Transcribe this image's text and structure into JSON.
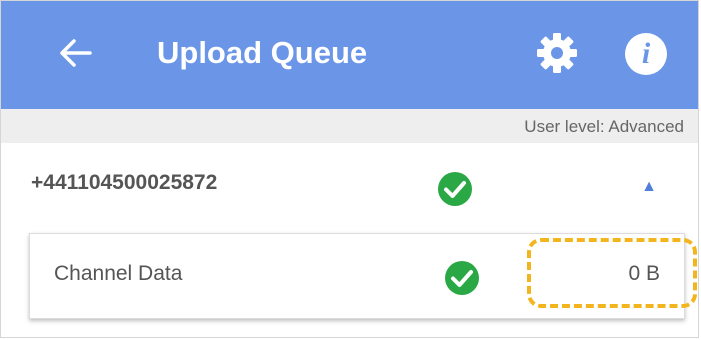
{
  "app_bar": {
    "title": "Upload Queue",
    "background_color": "#6b96e8",
    "back_icon": "arrow-left-icon",
    "settings_icon": "gear-icon",
    "info_icon": "info-icon",
    "info_glyph": "i"
  },
  "user_level": {
    "label": "User level: Advanced"
  },
  "device": {
    "id": "+441104500025872",
    "status_icon": "check-circle-icon",
    "status_color": "#2aa845",
    "toggle_icon": "triangle-up-icon",
    "toggle_glyph": "▲"
  },
  "channel": {
    "name": "Channel Data",
    "status_icon": "check-circle-icon",
    "size": "0 B"
  },
  "annotation": {
    "highlight_color": "#f2b51d"
  }
}
